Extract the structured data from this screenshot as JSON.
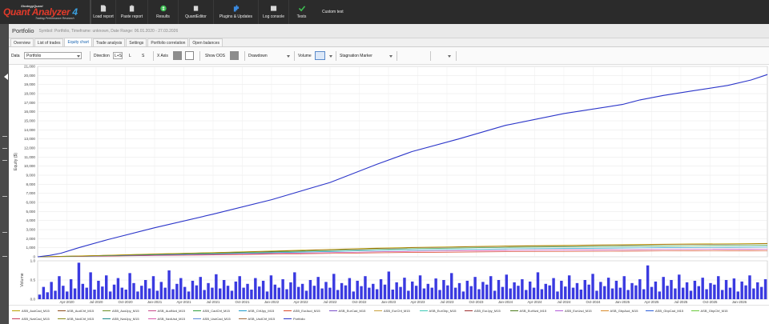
{
  "app": {
    "logo": {
      "line1": "StrategyQuant",
      "line2": "Quant Analyzer",
      "version": "4",
      "line3": "Trading Performance Research"
    },
    "toolbar": [
      {
        "id": "load-report",
        "label": "Load report",
        "icon": "document-icon",
        "color": "#d9d9d9"
      },
      {
        "id": "paste-report",
        "label": "Paste report",
        "icon": "clipboard-icon",
        "color": "#d9d9d9"
      },
      {
        "id": "results",
        "label": "Results",
        "icon": "dollar-icon",
        "color": "#3dbf52"
      },
      {
        "id": "quant-editor",
        "label": "QuantEditor",
        "icon": "gear-icon",
        "color": "#d9d9d9"
      },
      {
        "id": "plugins",
        "label": "Plugins & Updates",
        "icon": "puzzle-icon",
        "color": "#3a8ae0"
      },
      {
        "id": "log-console",
        "label": "Log console",
        "icon": "book-icon",
        "color": "#d9d9d9"
      },
      {
        "id": "tests",
        "label": "Tests",
        "icon": "check-icon",
        "color": "#3dbf52"
      }
    ],
    "custom_test": "Custom test"
  },
  "header": {
    "title": "Portfolio",
    "info": "Symbol: Portfolio, Timeframe: unknown, Date Range: 06.01.2020 - 27.03.2026"
  },
  "tabs": [
    "Overview",
    "List of trades",
    "Equity chart",
    "Trade analysis",
    "Settings",
    "Portfolio correlation",
    "Open balances"
  ],
  "active_tab": "Equity chart",
  "chart_toolbar": {
    "data_label": "Data",
    "data_value": "Portfolio",
    "direction_label": "Direction",
    "direction_options": [
      "L+S",
      "L",
      "S"
    ],
    "xaxis_label": "X Axis",
    "show_oos_label": "Show OOS",
    "drawdown_label": "Drawdown",
    "volume_label": "Volume",
    "stagnation_label": "Stagnation Marker"
  },
  "chart_data": [
    {
      "type": "line",
      "ylabel": "Equity ($)",
      "ylim": [
        0,
        21000
      ],
      "yticks": [
        "0",
        "1,000",
        "2,000",
        "3,000",
        "4,000",
        "5,000",
        "6,000",
        "7,000",
        "8,000",
        "9,000",
        "10,000",
        "11,000",
        "12,000",
        "13,000",
        "14,000",
        "15,000",
        "16,000",
        "17,000",
        "18,000",
        "19,000",
        "20,000",
        "21,000"
      ],
      "grid": true,
      "x": [
        2020.0,
        2020.1,
        2020.2,
        2020.35,
        2020.6,
        2021.0,
        2021.5,
        2022.0,
        2022.5,
        2022.9,
        2023.2,
        2023.6,
        2024.0,
        2024.5,
        2025.0,
        2025.15,
        2025.35,
        2025.6,
        2025.9,
        2026.1,
        2026.24
      ],
      "series": [
        {
          "name": "Portfolio",
          "color": "#2b35c9",
          "values": [
            0,
            150,
            400,
            1000,
            1900,
            3200,
            4700,
            6300,
            8200,
            10200,
            11600,
            13000,
            14500,
            15800,
            16800,
            17300,
            17800,
            18300,
            18900,
            19500,
            20100
          ]
        },
        {
          "name": "ASB_AudCad_M15",
          "color": "#b9a100",
          "values": [
            0,
            30,
            60,
            100,
            180,
            320,
            470,
            640,
            820,
            960,
            1040,
            1120,
            1200,
            1270,
            1340,
            1370,
            1390,
            1420,
            1440,
            1460,
            1480
          ]
        },
        {
          "name": "ASB_AudChf_M15",
          "color": "#8b4a1a",
          "values": [
            0,
            25,
            55,
            90,
            170,
            300,
            450,
            610,
            780,
            920,
            1000,
            1080,
            1160,
            1230,
            1290,
            1320,
            1350,
            1380,
            1400,
            1420,
            1440
          ]
        },
        {
          "name": "ASB_EurUsd_M15",
          "color": "#2e9d3c",
          "values": [
            0,
            20,
            45,
            80,
            150,
            270,
            400,
            540,
            690,
            820,
            900,
            970,
            1040,
            1100,
            1160,
            1180,
            1200,
            1220,
            1240,
            1260,
            1280
          ]
        },
        {
          "name": "ASB_GbpJpy_M15",
          "color": "#1f9ac9",
          "values": [
            0,
            15,
            35,
            65,
            120,
            220,
            330,
            450,
            580,
            690,
            750,
            810,
            870,
            920,
            970,
            990,
            1010,
            1030,
            1050,
            1065,
            1080
          ]
        },
        {
          "name": "ASB_UsdCad_M15",
          "color": "#c93da1",
          "values": [
            0,
            12,
            28,
            50,
            95,
            170,
            260,
            360,
            460,
            550,
            600,
            650,
            700,
            740,
            780,
            795,
            810,
            825,
            840,
            850,
            860
          ]
        },
        {
          "name": "ASB_AudUsd_M15",
          "color": "#d8482a",
          "values": [
            0,
            10,
            22,
            40,
            75,
            140,
            210,
            290,
            370,
            440,
            480,
            520,
            560,
            590,
            620,
            630,
            640,
            650,
            660,
            670,
            680
          ]
        }
      ]
    },
    {
      "type": "bar",
      "ylabel": "Volume",
      "ylim": [
        0,
        1.0
      ],
      "yticks": [
        "0.0",
        "0.5",
        "1.0"
      ],
      "xticks": [
        "Apr-2020",
        "Jul-2020",
        "Oct-2020",
        "Jan-2021",
        "Apr-2021",
        "Jul-2021",
        "Oct-2021",
        "Jan-2022",
        "Apr-2022",
        "Jul-2022",
        "Oct-2022",
        "Jan-2023",
        "Apr-2023",
        "Jul-2023",
        "Oct-2023",
        "Jan-2024",
        "Apr-2024",
        "Jul-2024",
        "Oct-2024",
        "Jan-2025",
        "Apr-2025",
        "Jul-2025",
        "Oct-2025",
        "Jan-2026"
      ],
      "color": "#3a3ae0",
      "x_start": 2020.0,
      "x_end": 2026.24,
      "values": [
        0.12,
        0.32,
        0.18,
        0.45,
        0.22,
        0.6,
        0.35,
        0.2,
        0.52,
        0.28,
        0.95,
        0.4,
        0.3,
        0.7,
        0.25,
        0.48,
        0.33,
        0.62,
        0.2,
        0.38,
        0.55,
        0.3,
        0.25,
        0.68,
        0.42,
        0.2,
        0.35,
        0.5,
        0.28,
        0.6,
        0.22,
        0.45,
        0.3,
        0.75,
        0.26,
        0.4,
        0.55,
        0.32,
        0.2,
        0.48,
        0.36,
        0.58,
        0.24,
        0.42,
        0.3,
        0.65,
        0.28,
        0.5,
        0.35,
        0.22,
        0.46,
        0.6,
        0.3,
        0.4,
        0.25,
        0.55,
        0.33,
        0.48,
        0.2,
        0.62,
        0.38,
        0.3,
        0.52,
        0.26,
        0.44,
        0.7,
        0.32,
        0.4,
        0.22,
        0.5,
        0.35,
        0.58,
        0.28,
        0.45,
        0.3,
        0.66,
        0.24,
        0.42,
        0.36,
        0.55,
        0.2,
        0.48,
        0.34,
        0.6,
        0.3,
        0.4,
        0.26,
        0.52,
        0.38,
        0.72,
        0.25,
        0.44,
        0.32,
        0.56,
        0.22,
        0.46,
        0.35,
        0.62,
        0.28,
        0.4,
        0.3,
        0.54,
        0.24,
        0.5,
        0.36,
        0.68,
        0.3,
        0.42,
        0.2,
        0.48,
        0.34,
        0.58,
        0.26,
        0.45,
        0.38,
        0.6,
        0.22,
        0.5,
        0.32,
        0.64,
        0.28,
        0.44,
        0.35,
        0.52,
        0.24,
        0.46,
        0.3,
        0.7,
        0.26,
        0.4,
        0.36,
        0.55,
        0.2,
        0.48,
        0.33,
        0.62,
        0.3,
        0.42,
        0.25,
        0.5,
        0.38,
        0.66,
        0.22,
        0.45,
        0.34,
        0.56,
        0.28,
        0.48,
        0.3,
        0.6,
        0.24,
        0.42,
        0.36,
        0.52,
        0.26,
        0.88,
        0.32,
        0.46,
        0.2,
        0.58,
        0.35,
        0.5,
        0.28,
        0.64,
        0.3,
        0.44,
        0.22,
        0.48,
        0.34,
        0.56,
        0.26,
        0.42,
        0.38,
        0.6,
        0.24,
        0.5,
        0.3,
        0.54,
        0.2,
        0.46,
        0.36,
        0.62,
        0.28,
        0.44,
        0.32,
        0.52
      ]
    }
  ],
  "legend": [
    {
      "name": "ASB_AudCad_M15",
      "color": "#b9a100"
    },
    {
      "name": "ASB_AudChf_M15",
      "color": "#8b4a1a"
    },
    {
      "name": "ASB_AudJpy_M15",
      "color": "#6a8e23"
    },
    {
      "name": "ASB_AudNzd_M15",
      "color": "#c74b8a"
    },
    {
      "name": "ASB_CadChf_M15",
      "color": "#2e9d3c"
    },
    {
      "name": "ASB_ChfJpy_M15",
      "color": "#1f9ac9"
    },
    {
      "name": "ASB_EurAud_M15",
      "color": "#d8482a"
    },
    {
      "name": "ASB_EurCad_M15",
      "color": "#7b4fc9"
    },
    {
      "name": "ASB_EurChf_M15",
      "color": "#c9a13d"
    },
    {
      "name": "ASB_EurGbp_M15",
      "color": "#3dc9b5"
    },
    {
      "name": "ASB_EurJpy_M15",
      "color": "#9d2e2e"
    },
    {
      "name": "ASB_EurNzd_M15",
      "color": "#4a7a1a"
    },
    {
      "name": "ASB_EurUsd_M15",
      "color": "#b35dd8"
    },
    {
      "name": "ASB_GbpAud_M15",
      "color": "#d88a2a"
    },
    {
      "name": "ASB_GbpCad_M15",
      "color": "#2a5dd8"
    },
    {
      "name": "ASB_GbpChf_M15",
      "color": "#6ac93d"
    },
    {
      "name": "ASB_NzdCad_M15",
      "color": "#c93d5a"
    },
    {
      "name": "ASB_NzdChf_M15",
      "color": "#8a8a1a"
    },
    {
      "name": "ASB_NzdJpy_M15",
      "color": "#1a8a8a"
    },
    {
      "name": "ASB_NzdUsd_M15",
      "color": "#d85dab"
    },
    {
      "name": "ASB_UsdCad_M15",
      "color": "#5d8ad8"
    },
    {
      "name": "ASB_UsdChf_M15",
      "color": "#a16a3d"
    },
    {
      "name": "Portfolio",
      "color": "#2b35c9"
    }
  ]
}
